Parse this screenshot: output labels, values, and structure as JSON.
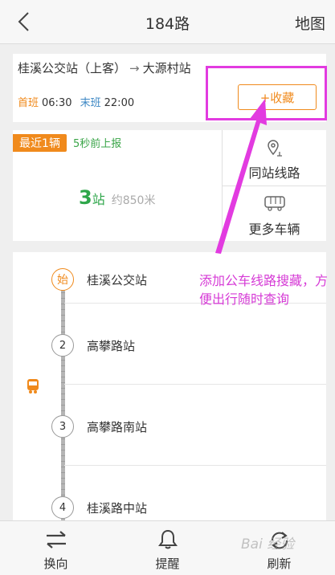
{
  "header": {
    "title": "184路",
    "back_icon": "chevron-left-icon",
    "map_label": "地图"
  },
  "route": {
    "from": "桂溪公交站（上客）",
    "arrow": "→",
    "to": "大源村站",
    "first_label": "首班",
    "first_time": "06:30",
    "last_label": "末班",
    "last_time": "22:00",
    "favorite_label": "+收藏"
  },
  "realtime": {
    "badge": "最近1辆",
    "report": "5秒前上报",
    "stations_num": "3",
    "stations_unit": "站",
    "distance": "约850米"
  },
  "side_actions": [
    {
      "label": "同站线路",
      "icon": "location-pin-icon"
    },
    {
      "label": "更多车辆",
      "icon": "bus-icon"
    }
  ],
  "stations": [
    {
      "marker": "始",
      "name": "桂溪公交站"
    },
    {
      "marker": "2",
      "name": "高攀路站"
    },
    {
      "marker": "3",
      "name": "高攀路南站"
    },
    {
      "marker": "4",
      "name": "桂溪路中站"
    }
  ],
  "annotation": {
    "text": "添加公车线路搜藏，方便出行随时查询",
    "color": "#e23be0"
  },
  "bottom_tabs": [
    {
      "label": "换向",
      "icon": "swap-icon"
    },
    {
      "label": "提醒",
      "icon": "bell-icon"
    },
    {
      "label": "刷新",
      "icon": "refresh-icon"
    }
  ],
  "watermark": "Bai 经验",
  "colors": {
    "accent": "#f08a1c",
    "green": "#2ea64a",
    "blue": "#3c87c4"
  }
}
